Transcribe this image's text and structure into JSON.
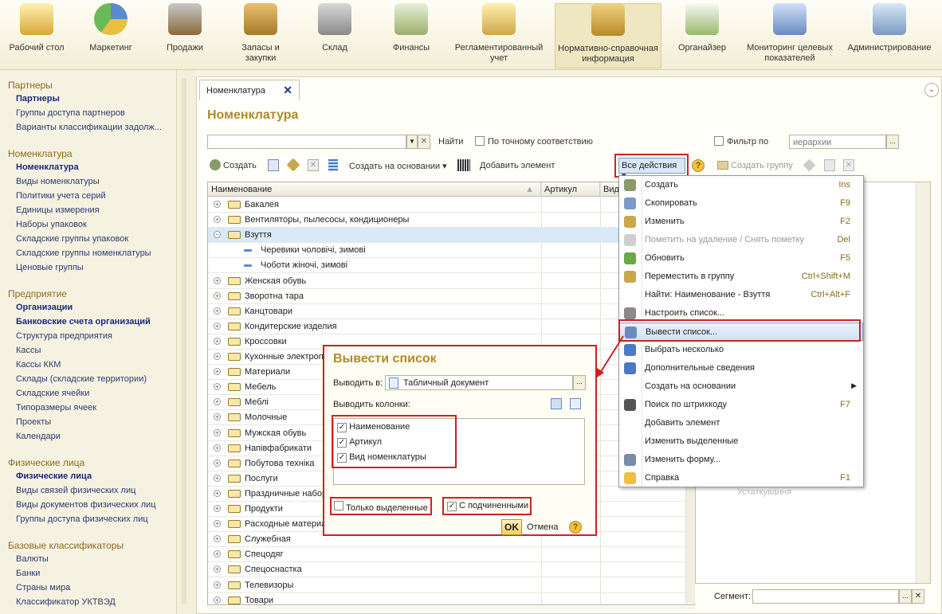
{
  "topbar": {
    "sections": [
      "Рабочий стол",
      "Маркетинг",
      "Продажи",
      "Запасы и закупки",
      "Склад",
      "Финансы",
      "Регламентированный учет",
      "Нормативно-справочная информация",
      "Органайзер",
      "Мониторинг целевых показателей",
      "Администрирование"
    ]
  },
  "sidebar": {
    "groups": [
      "Партнеры",
      "Номенклатура",
      "Предприятие",
      "Физические лица",
      "Базовые классификаторы"
    ],
    "g0": [
      "Партнеры",
      "Группы доступа партнеров",
      "Варианты классификации задолж..."
    ],
    "g1": [
      "Номенклатура",
      "Виды номенклатуры",
      "Политики учета серий",
      "Единицы измерения",
      "Наборы упаковок",
      "Складские группы упаковок",
      "Складские группы номенклатуры",
      "Ценовые группы"
    ],
    "g2": [
      "Организации",
      "Банковские счета организаций",
      "Структура предприятия",
      "Кассы",
      "Кассы ККМ",
      "Склады (складские территории)",
      "Складские ячейки",
      "Типоразмеры ячеек",
      "Проекты",
      "Календари"
    ],
    "g3": [
      "Физические лица",
      "Виды связей физических лиц",
      "Виды документов физических лиц",
      "Группы доступа физических лиц"
    ],
    "g4": [
      "Валюты",
      "Банки",
      "Страны мира",
      "Классификатор УКТВЭД"
    ]
  },
  "tab": {
    "label": "Номенклатура"
  },
  "page": {
    "title": "Номенклатура",
    "find_label": "Найти",
    "exact_label": "По точному соответствию",
    "filter_label": "Фильтр по",
    "filter_value": "иерархии"
  },
  "toolbar": {
    "create": "Создать",
    "create_basis": "Создать на основании",
    "add_element": "Добавить элемент",
    "all_actions": "Все действия",
    "create_group": "Создать группу"
  },
  "grid": {
    "headers": [
      "Наименование",
      "Артикул",
      "Вид"
    ],
    "rows": [
      "Бакалея",
      "Вентиляторы, пылесосы, кондиционеры",
      "Взуття",
      "Черевики чоловічі, зимові",
      "Чоботи жіночі, зимові",
      "Женская обувь",
      "Зворотна тара",
      "Канцтовари",
      "Кондитерские изделия",
      "Кроссовки",
      "Кухонные электроп",
      "Материали",
      "Мебель",
      "Меблі",
      "Молочные",
      "Мужская обувь",
      "Напівфабрикати",
      "Побутова техніка",
      "Послуги",
      "Праздничные набор",
      "Продукти",
      "Расходные материа",
      "Служебная",
      "Спецодяг",
      "Спецоснастка",
      "Телевизоры",
      "Товари"
    ]
  },
  "menu": {
    "items": [
      {
        "label": "Создать",
        "shortcut": "Ins"
      },
      {
        "label": "Скопировать",
        "shortcut": "F9"
      },
      {
        "label": "Изменить",
        "shortcut": "F2"
      },
      {
        "label": "Пометить на удаление / Снять пометку",
        "shortcut": "Del"
      },
      {
        "label": "Обновить",
        "shortcut": "F5"
      },
      {
        "label": "Переместить в группу",
        "shortcut": "Ctrl+Shift+M"
      },
      {
        "label": "Найти: Наименование - Взуття",
        "shortcut": "Ctrl+Alt+F"
      },
      {
        "label": "Настроить список...",
        "shortcut": ""
      },
      {
        "label": "Вывести список...",
        "shortcut": ""
      },
      {
        "label": "Выбрать несколько",
        "shortcut": ""
      },
      {
        "label": "Дополнительные сведения",
        "shortcut": ""
      },
      {
        "label": "Создать на основании",
        "shortcut": ""
      },
      {
        "label": "Поиск по штрихкоду",
        "shortcut": "F7"
      },
      {
        "label": "Добавить элемент",
        "shortcut": ""
      },
      {
        "label": "Изменить выделенные",
        "shortcut": ""
      },
      {
        "label": "Изменить форму...",
        "shortcut": ""
      },
      {
        "label": "Справка",
        "shortcut": "F1"
      }
    ]
  },
  "rightpanel": {
    "faint1": "ия",
    "faint2": "Устаткування",
    "segment_label": "Сегмент:"
  },
  "dialog": {
    "title": "Вывести список",
    "output_to_label": "Выводить в:",
    "output_to_value": "Табличный документ",
    "columns_label": "Выводить колонки:",
    "columns": [
      "Наименование",
      "Артикул",
      "Вид номенклатуры"
    ],
    "only_selected": "Только выделенные",
    "with_children": "С подчиненными",
    "ok": "OK",
    "cancel": "Отмена"
  },
  "colors": {
    "accent": "#b08a2a",
    "highlight_red": "#cc2222",
    "selected_row": "#d9e9f7"
  }
}
